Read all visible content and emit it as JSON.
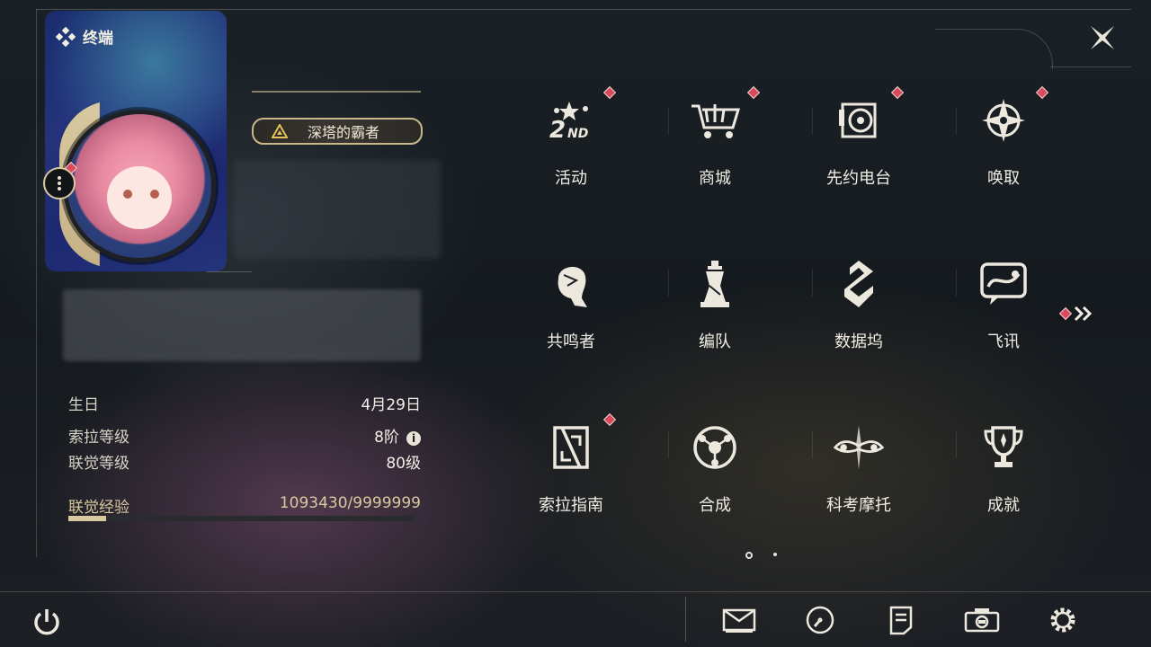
{
  "header": {
    "title": "终端"
  },
  "profile": {
    "title_badge": "深塔的霸者",
    "info": [
      {
        "key": "生日",
        "value": "4月29日"
      },
      {
        "key": "索拉等级",
        "value": "8阶"
      },
      {
        "key": "联觉等级",
        "value": "80级"
      }
    ],
    "exp": {
      "label": "联觉经验",
      "value": "1093430/9999999",
      "fraction": 0.109
    }
  },
  "menu": [
    {
      "label": "活动",
      "icon": "event-icon",
      "badge": true
    },
    {
      "label": "商城",
      "icon": "shop-cart-icon",
      "badge": true
    },
    {
      "label": "先约电台",
      "icon": "radio-icon",
      "badge": true
    },
    {
      "label": "唤取",
      "icon": "summon-compass-icon",
      "badge": true
    },
    {
      "label": "共鸣者",
      "icon": "resonator-head-icon",
      "badge": false
    },
    {
      "label": "编队",
      "icon": "chess-team-icon",
      "badge": false
    },
    {
      "label": "数据坞",
      "icon": "data-dock-icon",
      "badge": false
    },
    {
      "label": "飞讯",
      "icon": "chat-message-icon",
      "badge": false
    },
    {
      "label": "索拉指南",
      "icon": "guide-book-icon",
      "badge": true
    },
    {
      "label": "合成",
      "icon": "synthesis-icon",
      "badge": false
    },
    {
      "label": "科考摩托",
      "icon": "motorbike-icon",
      "badge": false
    },
    {
      "label": "成就",
      "icon": "trophy-icon",
      "badge": false
    }
  ],
  "pagination": {
    "current": 1,
    "total": 2
  },
  "bottom_bar": [
    {
      "name": "mail-button",
      "icon": "mail-icon"
    },
    {
      "name": "timer-button",
      "icon": "clock-icon"
    },
    {
      "name": "notice-button",
      "icon": "notice-icon"
    },
    {
      "name": "camera-button",
      "icon": "camera-icon"
    },
    {
      "name": "settings-button",
      "icon": "gear-icon"
    }
  ],
  "colors": {
    "accent": "#d8c9a0",
    "badge_red": "#d94b5b",
    "text": "#f1ede4"
  }
}
